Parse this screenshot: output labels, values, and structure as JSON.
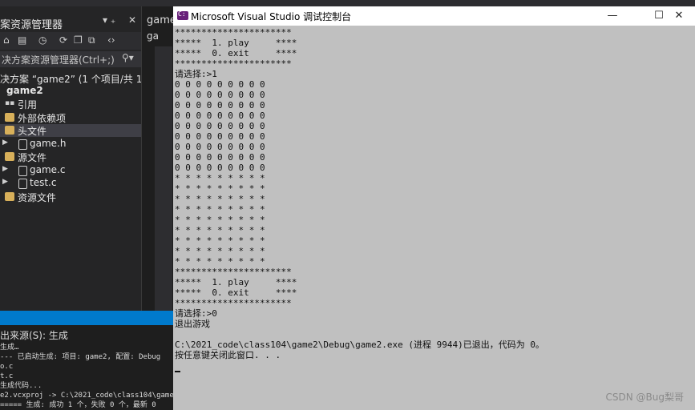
{
  "solution_explorer": {
    "title": "案资源管理器",
    "pin": "▾ ₊",
    "close": "✕",
    "search_placeholder": "决方案资源管理器(Ctrl+;)",
    "tree": [
      {
        "label": "决方案 “game2” (1 个项目/共 1 个)"
      },
      {
        "label": "game2"
      },
      {
        "label": "引用"
      },
      {
        "label": "外部依赖项"
      },
      {
        "label": "头文件"
      },
      {
        "label": "game.h"
      },
      {
        "label": "源文件"
      },
      {
        "label": "game.c"
      },
      {
        "label": "test.c"
      },
      {
        "label": "资源文件"
      }
    ]
  },
  "editor": {
    "tab": "game",
    "subtab": "ga"
  },
  "output": {
    "header": "出来源(S):  生成",
    "lines": "生成…\n--- 已启动生成: 项目: game2, 配置: Debug\no.c\nt.c\n生成代码...\ne2.vcxproj -> C:\\2021_code\\class104\\game2\n===== 生成: 成功 1 个，失败 0 个，最新 0"
  },
  "console": {
    "title": "Microsoft Visual Studio 调试控制台",
    "minimize": "—",
    "maximize": "☐",
    "close": "✕",
    "output": "**********************\n*****  1. play     ****\n*****  0. exit     ****\n**********************\n请选择:>1\n0 0 0 0 0 0 0 0 0\n0 0 0 0 0 0 0 0 0\n0 0 0 0 0 0 0 0 0\n0 0 0 0 0 0 0 0 0\n0 0 0 0 0 0 0 0 0\n0 0 0 0 0 0 0 0 0\n0 0 0 0 0 0 0 0 0\n0 0 0 0 0 0 0 0 0\n0 0 0 0 0 0 0 0 0\n* * * * * * * * *\n* * * * * * * * *\n* * * * * * * * *\n* * * * * * * * *\n* * * * * * * * *\n* * * * * * * * *\n* * * * * * * * *\n* * * * * * * * *\n* * * * * * * * *\n**********************\n*****  1. play     ****\n*****  0. exit     ****\n**********************\n请选择:>0\n退出游戏\n\nC:\\2021_code\\class104\\game2\\Debug\\game2.exe (进程 9944)已退出，代码为 0。\n按任意键关闭此窗口. . ."
  },
  "watermark": "CSDN @Bug梨哥"
}
